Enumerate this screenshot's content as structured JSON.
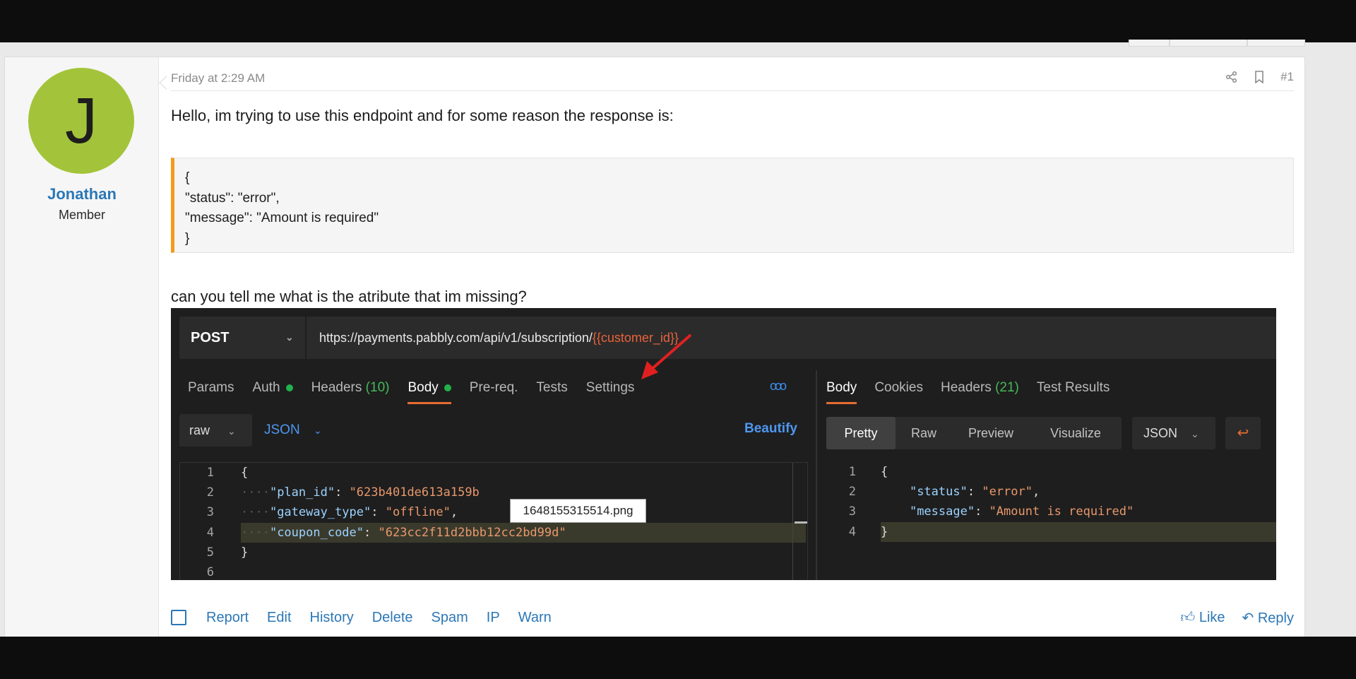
{
  "post": {
    "date": "Friday at 2:29 AM",
    "post_number": "#1",
    "author": {
      "initial": "J",
      "name": "Jonathan",
      "title": "Member",
      "avatar_color": "#a3c43a"
    },
    "paragraph1": "Hello, im trying to use this endpoint and for some reason the response is:",
    "quote_lines": [
      "{",
      "\"status\": \"error\",",
      "\"message\": \"Amount is required\"",
      "}"
    ],
    "paragraph2": "can you tell me what is the atribute that im missing?",
    "image_tooltip": "1648155315514.png"
  },
  "screenshot": {
    "method": "POST",
    "url_prefix": "https://payments.pabbly.com/api/v1/subscription/",
    "url_var": "{{customer_id}}",
    "left_tabs": {
      "params": "Params",
      "auth": "Auth",
      "headers": "Headers",
      "headers_count": "(10)",
      "body": "Body",
      "prereq": "Pre-req.",
      "tests": "Tests",
      "settings": "Settings"
    },
    "more": "ooo",
    "raw": "raw",
    "json": "JSON",
    "beautify": "Beautify",
    "right_tabs": {
      "body": "Body",
      "cookies": "Cookies",
      "headers": "Headers",
      "headers_count": "(21)",
      "test_results": "Test Results"
    },
    "views": {
      "pretty": "Pretty",
      "raw": "Raw",
      "preview": "Preview",
      "visualize": "Visualize"
    },
    "format": "JSON",
    "request_lines": [
      "1",
      "2",
      "3",
      "4",
      "5",
      "6"
    ],
    "request_code": {
      "open": "{",
      "k1": "\"plan_id\"",
      "v1": "\"623b401de613a159b",
      "k2": "\"gateway_type\"",
      "v2": "\"offline\"",
      "k3": "\"coupon_code\"",
      "v3": "\"623cc2f11d2bbb12cc2bd99d\"",
      "close": "}"
    },
    "response_lines": [
      "1",
      "2",
      "3",
      "4"
    ],
    "response_code": {
      "open": "{",
      "k1": "\"status\"",
      "v1": "\"error\"",
      "k2": "\"message\"",
      "v2": "\"Amount is required\"",
      "close": "}"
    }
  },
  "actions": {
    "links": [
      "Report",
      "Edit",
      "History",
      "Delete",
      "Spam",
      "IP",
      "Warn"
    ],
    "like": "Like",
    "reply": "Reply"
  },
  "colors": {
    "link": "#2c77b6",
    "quote_border": "#f39c1a",
    "postman_accent": "#e66c33"
  }
}
